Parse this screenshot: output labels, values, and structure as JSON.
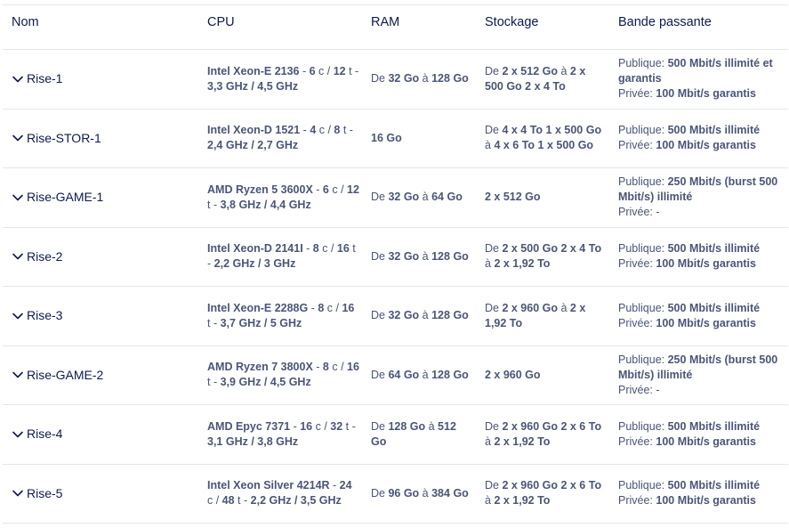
{
  "headers": {
    "nom": "Nom",
    "cpu": "CPU",
    "ram": "RAM",
    "stockage": "Stockage",
    "bande": "Bande passante"
  },
  "icons": {
    "expand": "chevron-down-icon"
  },
  "rows": [
    {
      "name": "Rise-1",
      "cpu": {
        "model": "Intel Xeon-E 2136",
        "cores": "6",
        "threads": "12",
        "freq": "3,3 GHz / 4,5 GHz"
      },
      "ram": {
        "prefix": "De",
        "from": "32 Go",
        "mid": "à",
        "to": "128 Go"
      },
      "storage": [
        {
          "t": "De ",
          "b": false
        },
        {
          "t": "2 x 512 Go",
          "b": true
        },
        {
          "t": " à ",
          "b": false
        },
        {
          "t": "2 x 500 Go 2 x 4 To",
          "b": true
        }
      ],
      "bw": {
        "pub_label": "Publique:",
        "pub": "500 Mbit/s illimité et garantis",
        "priv_label": "Privée:",
        "priv": "100 Mbit/s garantis"
      }
    },
    {
      "name": "Rise-STOR-1",
      "cpu": {
        "model": "Intel Xeon-D 1521",
        "cores": "4",
        "threads": "8",
        "freq": "2,4 GHz / 2,7 GHz"
      },
      "ram": {
        "prefix": "",
        "from": "16 Go",
        "mid": "",
        "to": ""
      },
      "storage": [
        {
          "t": "De ",
          "b": false
        },
        {
          "t": "4 x 4 To 1 x 500 Go",
          "b": true
        },
        {
          "t": " à ",
          "b": false
        },
        {
          "t": "4 x 6 To 1 x 500 Go",
          "b": true
        }
      ],
      "bw": {
        "pub_label": "Publique:",
        "pub": "500 Mbit/s illimité",
        "priv_label": "Privée:",
        "priv": "100 Mbit/s garantis"
      }
    },
    {
      "name": "Rise-GAME-1",
      "cpu": {
        "model": "AMD Ryzen 5 3600X",
        "cores": "6",
        "threads": "12",
        "freq": "3,8 GHz / 4,4 GHz"
      },
      "ram": {
        "prefix": "De",
        "from": "32 Go",
        "mid": "à",
        "to": "64 Go"
      },
      "storage": [
        {
          "t": "2 x 512 Go",
          "b": true
        }
      ],
      "bw": {
        "pub_label": "Publique:",
        "pub": "250 Mbit/s (burst 500 Mbit/s) illimité",
        "priv_label": "Privée:",
        "priv": "-"
      }
    },
    {
      "name": "Rise-2",
      "cpu": {
        "model": "Intel Xeon-D 2141I",
        "cores": "8",
        "threads": "16",
        "freq": "2,2 GHz / 3 GHz"
      },
      "ram": {
        "prefix": "De",
        "from": "32 Go",
        "mid": "à",
        "to": "128 Go"
      },
      "storage": [
        {
          "t": "De ",
          "b": false
        },
        {
          "t": "2 x 500 Go 2 x 4 To",
          "b": true
        },
        {
          "t": " à ",
          "b": false
        },
        {
          "t": "2 x 1,92 To",
          "b": true
        }
      ],
      "bw": {
        "pub_label": "Publique:",
        "pub": "500 Mbit/s illimité",
        "priv_label": "Privée:",
        "priv": "100 Mbit/s garantis"
      }
    },
    {
      "name": "Rise-3",
      "cpu": {
        "model": "Intel Xeon-E 2288G",
        "cores": "8",
        "threads": "16",
        "freq": "3,7 GHz / 5 GHz"
      },
      "ram": {
        "prefix": "De",
        "from": "32 Go",
        "mid": "à",
        "to": "128 Go"
      },
      "storage": [
        {
          "t": "De ",
          "b": false
        },
        {
          "t": "2 x 960 Go",
          "b": true
        },
        {
          "t": " à ",
          "b": false
        },
        {
          "t": "2 x 1,92 To",
          "b": true
        }
      ],
      "bw": {
        "pub_label": "Publique:",
        "pub": "500 Mbit/s illimité",
        "priv_label": "Privée:",
        "priv": "100 Mbit/s garantis"
      }
    },
    {
      "name": "Rise-GAME-2",
      "cpu": {
        "model": "AMD Ryzen 7 3800X",
        "cores": "8",
        "threads": "16",
        "freq": "3,9 GHz / 4,5 GHz"
      },
      "ram": {
        "prefix": "De",
        "from": "64 Go",
        "mid": "à",
        "to": "128 Go"
      },
      "storage": [
        {
          "t": "2 x 960 Go",
          "b": true
        }
      ],
      "bw": {
        "pub_label": "Publique:",
        "pub": "250 Mbit/s (burst 500 Mbit/s) illimité",
        "priv_label": "Privée:",
        "priv": "-"
      }
    },
    {
      "name": "Rise-4",
      "cpu": {
        "model": "AMD Epyc 7371",
        "cores": "16",
        "threads": "32",
        "freq": "3,1 GHz / 3,8 GHz"
      },
      "ram": {
        "prefix": "De",
        "from": "128 Go",
        "mid": "à",
        "to": "512 Go"
      },
      "storage": [
        {
          "t": "De ",
          "b": false
        },
        {
          "t": "2 x 960 Go 2 x 6 To",
          "b": true
        },
        {
          "t": " à ",
          "b": false
        },
        {
          "t": "2 x 1,92 To",
          "b": true
        }
      ],
      "bw": {
        "pub_label": "Publique:",
        "pub": "500 Mbit/s illimité",
        "priv_label": "Privée:",
        "priv": "100 Mbit/s garantis"
      }
    },
    {
      "name": "Rise-5",
      "cpu": {
        "model": "Intel Xeon Silver 4214R",
        "cores": "24",
        "threads": "48",
        "freq": "2,2 GHz / 3,5 GHz"
      },
      "ram": {
        "prefix": "De",
        "from": "96 Go",
        "mid": "à",
        "to": "384 Go"
      },
      "storage": [
        {
          "t": "De ",
          "b": false
        },
        {
          "t": "2 x 960 Go 2 x 6 To",
          "b": true
        },
        {
          "t": " à ",
          "b": false
        },
        {
          "t": "2 x 1,92 To",
          "b": true
        }
      ],
      "bw": {
        "pub_label": "Publique:",
        "pub": "500 Mbit/s illimité",
        "priv_label": "Privée:",
        "priv": "100 Mbit/s garantis"
      }
    }
  ],
  "labels": {
    "cores_unit": "c",
    "threads_unit": "t",
    "sep": " - ",
    "slash": " / "
  }
}
